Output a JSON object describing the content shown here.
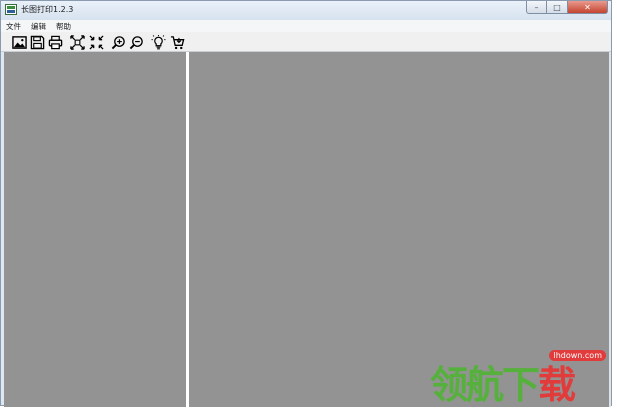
{
  "window": {
    "title": "长图打印1.2.3",
    "minimize_glyph": "–",
    "maximize_glyph": "□",
    "close_glyph": "✕"
  },
  "menu": [
    {
      "label": "文件"
    },
    {
      "label": "编辑"
    },
    {
      "label": "帮助"
    }
  ],
  "toolbar": {
    "icons": [
      "open-image-icon",
      "save-icon",
      "print-icon",
      "fit-width-icon",
      "fit-page-icon",
      "zoom-in-icon",
      "zoom-out-icon",
      "lightbulb-icon",
      "cart-icon"
    ]
  },
  "watermark": {
    "url": "lhdown.com",
    "text_green": "领航下",
    "text_red": "载"
  },
  "colors": {
    "pane_bg": "#939393",
    "splitter": "#ffffff",
    "titlebar": "#dfe8f2",
    "watermark_green": "#55b13b",
    "watermark_red": "#e23b3b"
  }
}
